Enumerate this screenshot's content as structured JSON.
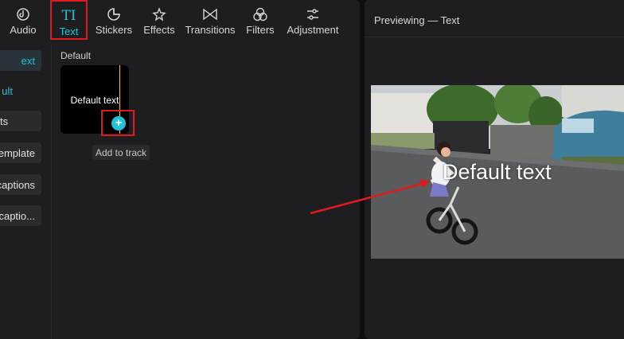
{
  "toolbar": {
    "tabs": [
      {
        "label": "Audio",
        "icon": "audio-icon"
      },
      {
        "label": "Text",
        "icon": "text-icon",
        "active": true
      },
      {
        "label": "Stickers",
        "icon": "stickers-icon"
      },
      {
        "label": "Effects",
        "icon": "effects-icon"
      },
      {
        "label": "Transitions",
        "icon": "transitions-icon"
      },
      {
        "label": "Filters",
        "icon": "filters-icon"
      },
      {
        "label": "Adjustment",
        "icon": "adjustment-icon"
      }
    ],
    "text_glyph": "TI"
  },
  "sidebar": {
    "items": [
      {
        "label": "ext"
      },
      {
        "label": "ult"
      },
      {
        "label": "ts"
      },
      {
        "label": "emplate"
      },
      {
        "label": "captions"
      },
      {
        "label": "captio..."
      }
    ]
  },
  "library": {
    "section_label": "Default",
    "card_text": "Default text",
    "add_symbol": "+",
    "tooltip": "Add to track"
  },
  "preview": {
    "title": "Previewing — Text",
    "overlay_text": "Default text"
  },
  "colors": {
    "accent": "#22c1d6",
    "highlight": "#e01b1b",
    "playhead": "#e8c43a"
  }
}
